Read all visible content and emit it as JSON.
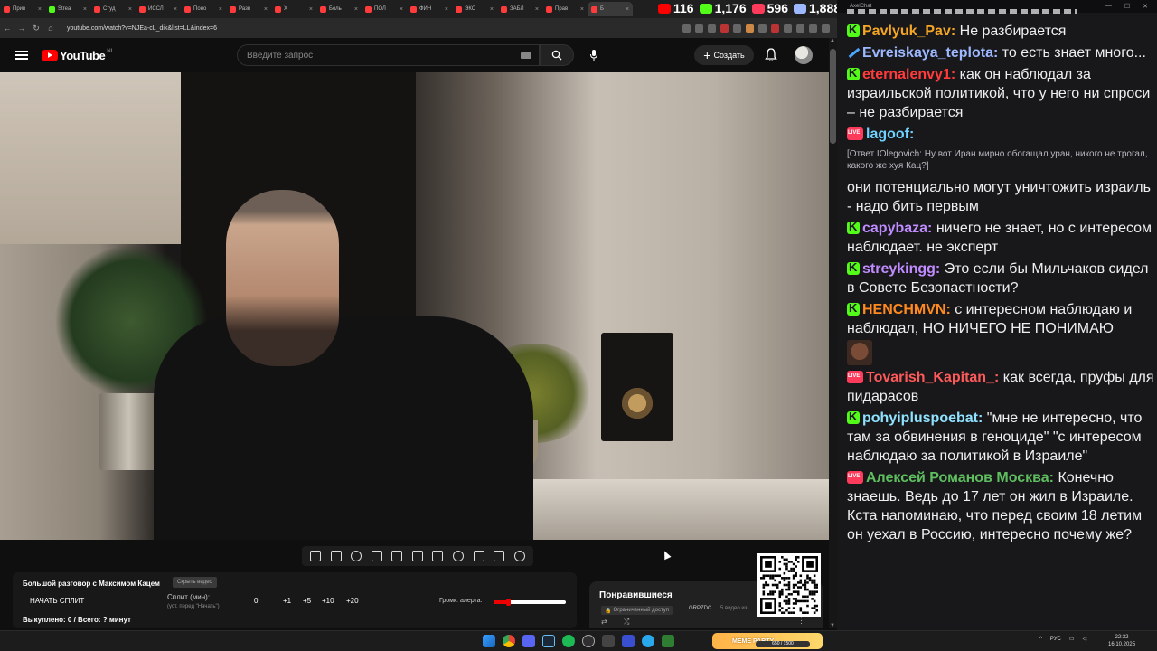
{
  "browser": {
    "tabs": [
      {
        "label": "Прив",
        "color": "#ff3b3b"
      },
      {
        "label": "Strea",
        "color": "#53fc18"
      },
      {
        "label": "Студ",
        "color": "#ff3b3b"
      },
      {
        "label": "ИССЛ",
        "color": "#ff3b3b"
      },
      {
        "label": "Поно",
        "color": "#ff3b3b"
      },
      {
        "label": "Разв",
        "color": "#ff3b3b"
      },
      {
        "label": "Х",
        "color": "#ff3b3b"
      },
      {
        "label": "Боль",
        "color": "#ff3b3b"
      },
      {
        "label": "ПОЛ",
        "color": "#ff3b3b"
      },
      {
        "label": "ФИН",
        "color": "#ff3b3b"
      },
      {
        "label": "ЭКС",
        "color": "#ff3b3b"
      },
      {
        "label": "ЗАБЛ",
        "color": "#ff3b3b"
      },
      {
        "label": "Прав",
        "color": "#ff3b3b"
      },
      {
        "label": "Б",
        "color": "#ff3b3b",
        "active": true
      }
    ],
    "url": "youtube.com/watch?v=NJEa-cL_dik&list=LL&index=6"
  },
  "stream_stats": [
    {
      "value": "116",
      "color": "#ff0000",
      "icon": "youtube-icon"
    },
    {
      "value": "1,176",
      "color": "#53fc18",
      "icon": "kick-icon"
    },
    {
      "value": "596",
      "color": "#ff3b5c",
      "icon": "live-icon"
    },
    {
      "value": "1,888",
      "color": "#9db8ff",
      "icon": "people-icon"
    }
  ],
  "youtube": {
    "logo": "YouTube",
    "region": "NL",
    "search_placeholder": "Введите запрос",
    "create_label": "Создать"
  },
  "toolbar_icons": [
    "loop-icon",
    "sort-icon",
    "audio-icon",
    "video-camera-icon",
    "clapper-icon",
    "pip-icon",
    "film-icon",
    "speed-icon",
    "screenshot-add-icon",
    "camera-icon",
    "settings-gear-icon"
  ],
  "split": {
    "title": "Большой разговор с Максимом Кацем",
    "hide_label": "Скрыть видео",
    "start_label": "НАЧАТЬ СПЛИТ",
    "minutes_label": "Сплит (мин):",
    "hint": "(уст. перед \"Начать\")",
    "value": "0",
    "plus1": "+1",
    "plus5": "+5",
    "plus10": "+10",
    "plus20": "+20",
    "alert_label": "Громк. алерта:",
    "alert_level": 0.2,
    "status": "Выкуплено: 0 / Всего: ? минут"
  },
  "playlist": {
    "title": "Понравившиеся",
    "access": "Ограниченный доступ",
    "owner": "GRPZDC",
    "count": "5 видео из"
  },
  "chat": {
    "window_title": "AxelChat",
    "messages": [
      {
        "badge": "kick",
        "user": "Pavlyuk_Pav:",
        "color": "#f5a623",
        "text": " Не разбирается"
      },
      {
        "badge": "sword",
        "user": "Evreiskaya_teplota:",
        "color": "#9db8ff",
        "text": " то есть знает много..."
      },
      {
        "badge": "kick",
        "user": "eternalenvy1:",
        "color": "#ff3b3b",
        "text": " как он наблюдал за израильской политикой, что у него ни спроси – не разбирается"
      },
      {
        "badge": "live",
        "user": "lagoof:",
        "color": "#6fd3ff",
        "reply": "[Ответ IOlegovich: Ну вот Иран мирно обогащал уран, никого не трогал, какого же хуя Кац?]",
        "text": "они потенциально могут уничтожить израиль - надо бить первым"
      },
      {
        "badge": "kick",
        "user": "capybaza:",
        "color": "#c08cff",
        "text": " ничего не знает, но с интересом наблюдает. не эксперт"
      },
      {
        "badge": "kick",
        "user": "streykingg:",
        "color": "#c08cff",
        "text": " Это если бы Мильчаков сидел в Совете Безопастности?"
      },
      {
        "badge": "kick",
        "user": "HENCHMVN:",
        "color": "#ff8a1f",
        "text": " с интересном наблюдаю и наблюдал, НО НИЧЕГО НЕ ПОНИМАЮ",
        "emote": "face-emote"
      },
      {
        "badge": "live",
        "user": "Tovarish_Kapitan_:",
        "color": "#ff5a5a",
        "text": " как всегда, пруфы для пидарасов"
      },
      {
        "badge": "kick",
        "user": "pohyiplusроebat:",
        "color": "#8fe3ff",
        "text": " \"мне не интересно, что там за обвинения в геноциде\" \"с интересом наблюдаю за политикой в Израиле\""
      },
      {
        "badge": "live",
        "user": "Алексей Романов Москва:",
        "color": "#5fbf5f",
        "text": " Конечно знаешь. Ведь до 17 лет он жил в Израиле. Кста напоминаю, что перед своим 18 летим он уехал в Россию, интересно почему же?"
      }
    ]
  },
  "taskbar": {
    "meme_label": "MEME PARTY",
    "meme_progress": "650 / 1500",
    "lang": "РУС",
    "time": "22:32",
    "date": "16.10.2025"
  }
}
